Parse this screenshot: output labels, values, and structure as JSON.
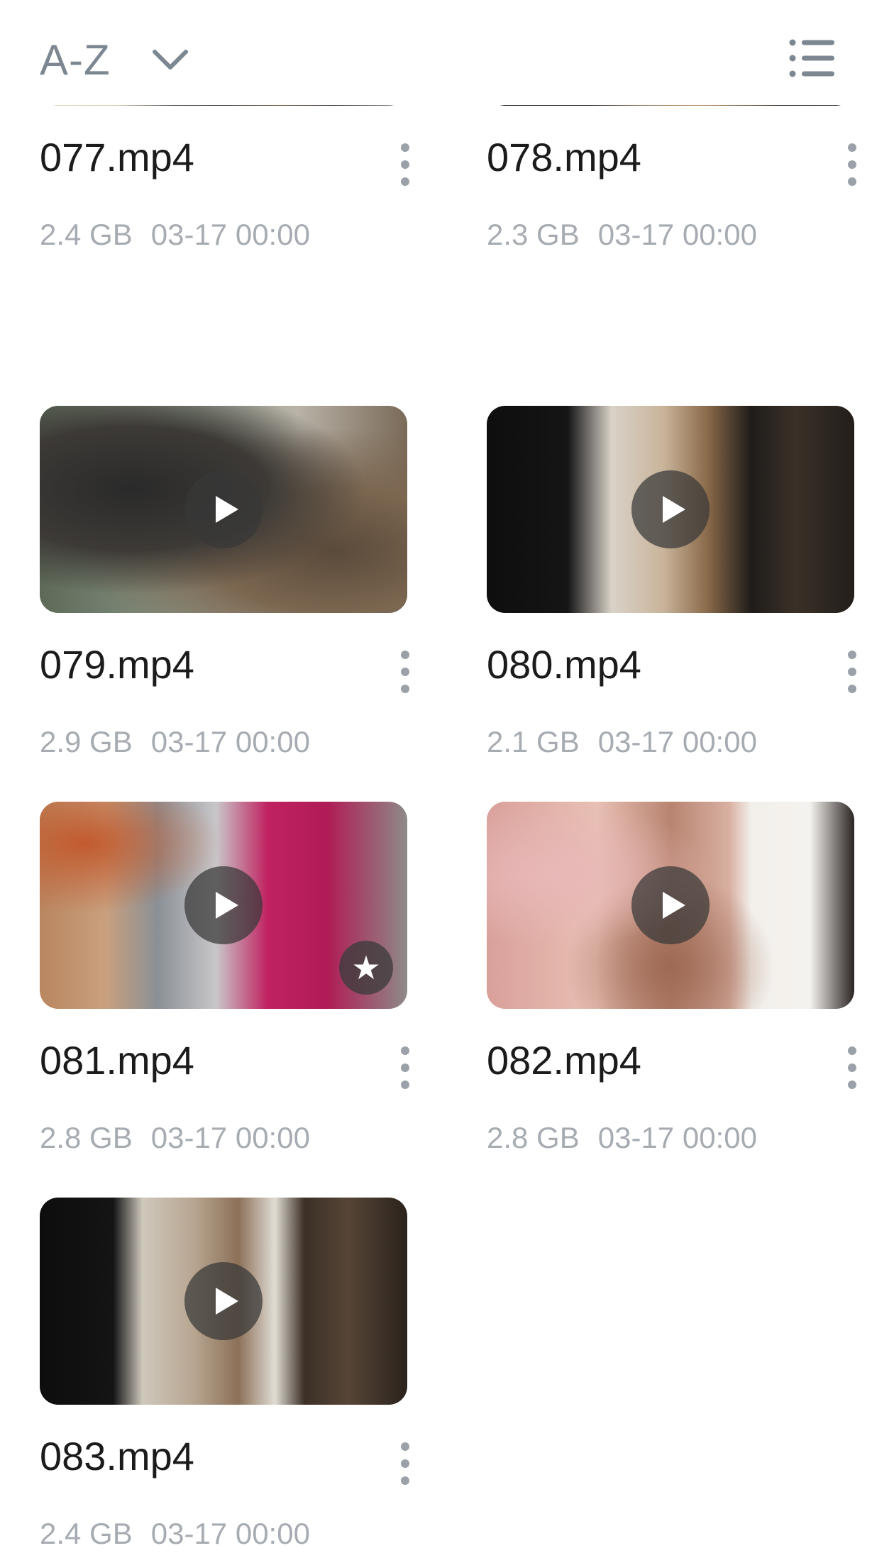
{
  "header": {
    "sort_label": "A-Z",
    "sort_icon": "chevron-down-icon",
    "menu_icon": "list-menu-icon"
  },
  "files": [
    {
      "name": "077.mp4",
      "size": "2.4 GB",
      "date": "03-17 00:00",
      "starred": false
    },
    {
      "name": "078.mp4",
      "size": "2.3 GB",
      "date": "03-17 00:00",
      "starred": false
    },
    {
      "name": "079.mp4",
      "size": "2.9 GB",
      "date": "03-17 00:00",
      "starred": false
    },
    {
      "name": "080.mp4",
      "size": "2.1 GB",
      "date": "03-17 00:00",
      "starred": false
    },
    {
      "name": "081.mp4",
      "size": "2.8 GB",
      "date": "03-17 00:00",
      "starred": true
    },
    {
      "name": "082.mp4",
      "size": "2.8 GB",
      "date": "03-17 00:00",
      "starred": false
    },
    {
      "name": "083.mp4",
      "size": "2.4 GB",
      "date": "03-17 00:00",
      "starred": false
    }
  ]
}
